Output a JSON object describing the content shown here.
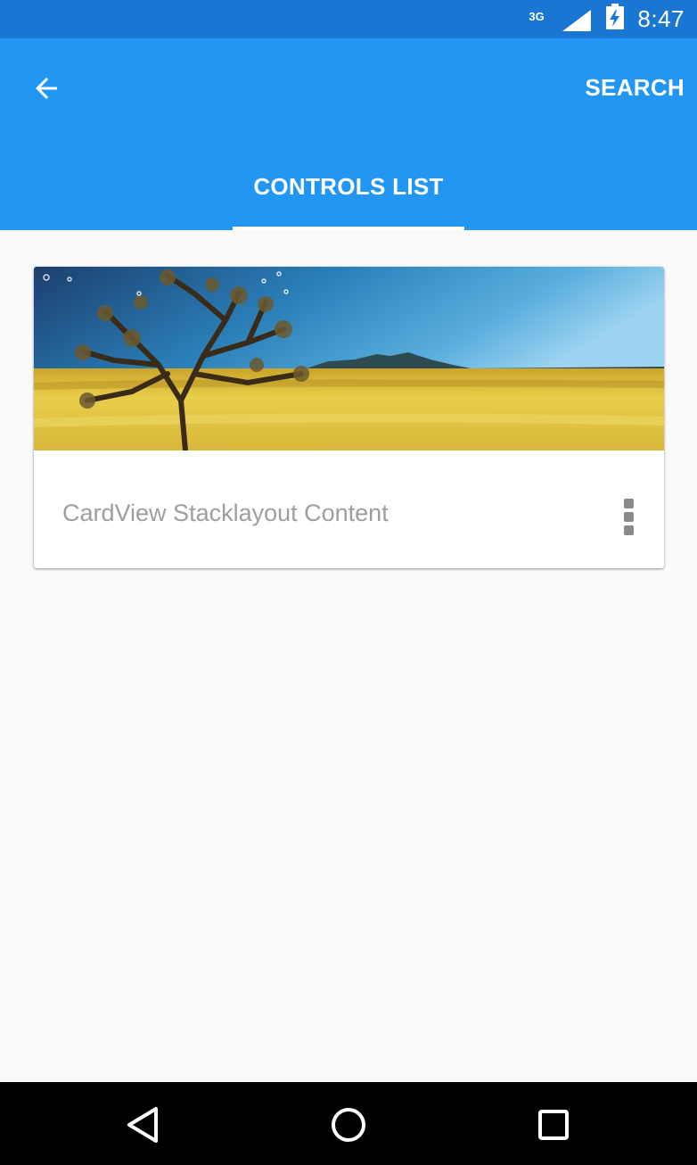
{
  "status_bar": {
    "network_type": "3G",
    "time": "8:47",
    "icons": [
      "signal-icon",
      "battery-charging-icon"
    ]
  },
  "app_bar": {
    "back_icon": "back-arrow-icon",
    "search_label": "SEARCH",
    "background_color": "#2196f3",
    "status_color": "#1976d2"
  },
  "tabs": [
    {
      "label": "CONTROLS LIST",
      "selected": true
    }
  ],
  "card": {
    "image_description_icon": "landscape-image",
    "text": "CardView Stacklayout Content",
    "menu_icon": "more-vert-icon"
  },
  "nav_bar": {
    "buttons": [
      "back-triangle-icon",
      "home-circle-icon",
      "recents-square-icon"
    ]
  }
}
